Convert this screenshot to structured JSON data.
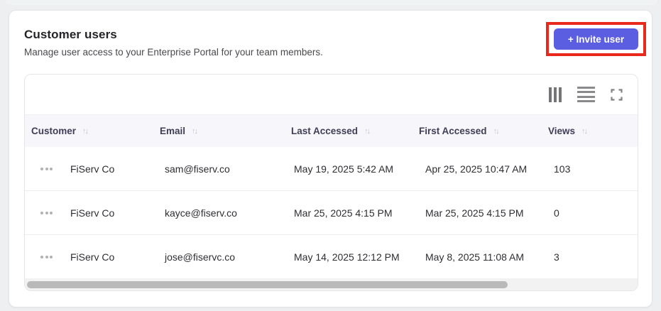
{
  "page": {
    "title": "Customer users",
    "subtitle": "Manage user access to your Enterprise Portal for your team members."
  },
  "header": {
    "invite_button_label": "+ Invite user"
  },
  "toolbar": {
    "icons": [
      "view-columns-icon",
      "row-density-icon",
      "fullscreen-icon"
    ]
  },
  "table": {
    "columns": [
      "Customer",
      "Email",
      "Last Accessed",
      "First Accessed",
      "Views"
    ],
    "sort_icon": "↑↓",
    "rows": [
      {
        "customer": "FiServ Co",
        "email": "sam@fiserv.co",
        "last_accessed": "May 19, 2025 5:42 AM",
        "first_accessed": "Apr 25, 2025 10:47 AM",
        "views": "103"
      },
      {
        "customer": "FiServ Co",
        "email": "kayce@fiserv.co",
        "last_accessed": "Mar 25, 2025 4:15 PM",
        "first_accessed": "Mar 25, 2025 4:15 PM",
        "views": "0"
      },
      {
        "customer": "FiServ Co",
        "email": "jose@fiservc.co",
        "last_accessed": "May 14, 2025 12:12 PM",
        "first_accessed": "May 8, 2025 11:08 AM",
        "views": "3"
      }
    ]
  },
  "colors": {
    "accent_button": "#5b5ee1",
    "annotation_highlight": "#e8291c",
    "table_header_bg": "#f6f6fb"
  }
}
